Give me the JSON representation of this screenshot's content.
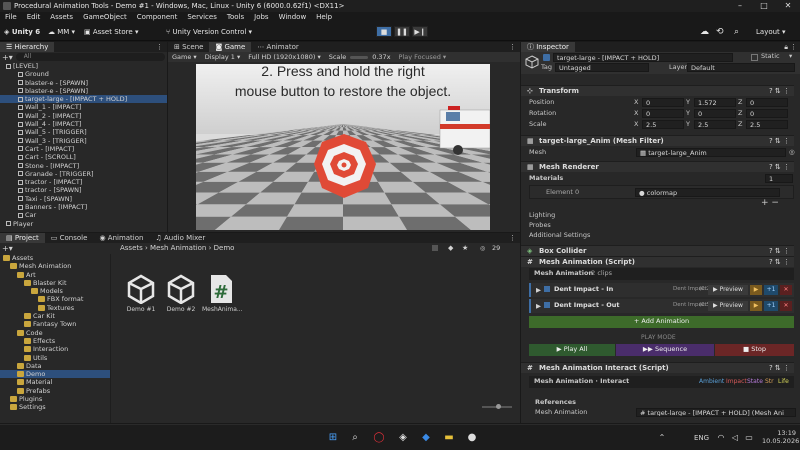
{
  "titlebar": {
    "title": "Procedural Animation Tools - Demo #1 - Windows, Mac, Linux - Unity 6 (6000.0.62f1) <DX11>"
  },
  "menu": [
    "File",
    "Edit",
    "Assets",
    "GameObject",
    "Component",
    "Services",
    "Tools",
    "Jobs",
    "Window",
    "Help"
  ],
  "toolbar": {
    "unity": "Unity 6",
    "account": "MM",
    "asset_store": "Asset Store",
    "version_control": "Unity Version Control",
    "layout": "Layout"
  },
  "hierarchy": {
    "tab": "Hierarchy",
    "search_placeholder": "All",
    "items": [
      {
        "label": "[LEVEL]"
      },
      {
        "label": "Ground"
      },
      {
        "label": "blaster-e - [SPAWN]"
      },
      {
        "label": "blaster-e - [SPAWN]"
      },
      {
        "label": "target-large - [IMPACT + HOLD]"
      },
      {
        "label": "Wall_1 - [IMPACT]"
      },
      {
        "label": "Wall_2 - [IMPACT]"
      },
      {
        "label": "Wall_4 - [IMPACT]"
      },
      {
        "label": "Wall_5 - [TRIGGER]"
      },
      {
        "label": "Wall_3 - [TRIGGER]"
      },
      {
        "label": "Cart - [IMPACT]"
      },
      {
        "label": "Cart - [SCROLL]"
      },
      {
        "label": "Stone - [IMPACT]"
      },
      {
        "label": "Granade - [TRIGGER]"
      },
      {
        "label": "tractor - [IMPACT]"
      },
      {
        "label": "tractor - [SPAWN]"
      },
      {
        "label": "Taxi - [SPAWN]"
      },
      {
        "label": "Banners - [IMPACT]"
      },
      {
        "label": "Car"
      },
      {
        "label": "Player"
      }
    ]
  },
  "scene_tabs": {
    "scene": "Scene",
    "game": "Game",
    "animator": "Animator"
  },
  "game_bar": {
    "game": "Game",
    "display": "Display 1",
    "resolution": "Full HD (1920x1080)",
    "scale_label": "Scale",
    "scale_value": "0.37x",
    "play_focused": "Play Focused"
  },
  "game_view": {
    "line1": "2. Press and hold the right",
    "line2": "mouse button to restore the object."
  },
  "project": {
    "tabs": {
      "project": "Project",
      "console": "Console",
      "animation": "Animation",
      "audio": "Audio Mixer"
    },
    "breadcrumb": [
      "Assets",
      "Mesh Animation",
      "Demo"
    ],
    "count": "29",
    "tree": [
      {
        "label": "Assets",
        "depth": 0
      },
      {
        "label": "Mesh Animation",
        "depth": 1
      },
      {
        "label": "Art",
        "depth": 2
      },
      {
        "label": "Blaster Kit",
        "depth": 3
      },
      {
        "label": "Models",
        "depth": 4
      },
      {
        "label": "FBX format",
        "depth": 5
      },
      {
        "label": "Textures",
        "depth": 5
      },
      {
        "label": "Car Kit",
        "depth": 3
      },
      {
        "label": "Fantasy Town",
        "depth": 3
      },
      {
        "label": "Code",
        "depth": 2
      },
      {
        "label": "Effects",
        "depth": 3
      },
      {
        "label": "Interaction",
        "depth": 3
      },
      {
        "label": "Utils",
        "depth": 3
      },
      {
        "label": "Data",
        "depth": 2
      },
      {
        "label": "Demo",
        "depth": 2,
        "selected": true
      },
      {
        "label": "Material",
        "depth": 2
      },
      {
        "label": "Prefabs",
        "depth": 2
      },
      {
        "label": "Plugins",
        "depth": 1
      },
      {
        "label": "Settings",
        "depth": 1
      }
    ],
    "assets": [
      {
        "label": "Demo #1",
        "icon": "unity-scene-icon"
      },
      {
        "label": "Demo #2",
        "icon": "unity-scene-icon"
      },
      {
        "label": "MeshAnima...",
        "icon": "csharp-script-icon"
      }
    ]
  },
  "inspector": {
    "tab": "Inspector",
    "name": "target-large - [IMPACT + HOLD]",
    "static": "Static",
    "tag_label": "Tag",
    "tag": "Untagged",
    "layer_label": "Layer",
    "layer": "Default",
    "transform": {
      "title": "Transform",
      "position": {
        "label": "Position",
        "x": "0",
        "y": "1.572",
        "z": "0"
      },
      "rotation": {
        "label": "Rotation",
        "x": "0",
        "y": "0",
        "z": "0"
      },
      "scale": {
        "label": "Scale",
        "x": "2.5",
        "y": "2.5",
        "z": "2.5"
      }
    },
    "mesh_filter": {
      "title": "target-large_Anim (Mesh Filter)",
      "mesh_label": "Mesh",
      "mesh": "target-large_Anim"
    },
    "mesh_renderer": {
      "title": "Mesh Renderer",
      "materials_label": "Materials",
      "materials_count": "1",
      "element_label": "Element 0",
      "element": "colormap",
      "lighting": "Lighting",
      "probes": "Probes",
      "additional": "Additional Settings"
    },
    "box_collider": "Box Collider",
    "mesh_animation": {
      "title": "Mesh Animation (Script)",
      "header": "Mesh Animation",
      "clips": "2 clips",
      "rows": [
        {
          "name": "Dent Impact - In",
          "tag": "Dent Impact",
          "time": "(0.2s)",
          "preview": "Preview"
        },
        {
          "name": "Dent Impact - Out",
          "tag": "Dent Impact",
          "time": "(0.5s)",
          "preview": "Preview"
        }
      ],
      "add": "+ Add Animation",
      "play_mode": "PLAY MODE",
      "play_all": "Play All",
      "sequence": "Sequence",
      "stop": "Stop",
      "plus_one": "+1"
    },
    "interact": {
      "title": "Mesh Animation Interact (Script)",
      "header": "Mesh Animation",
      "header_sep": "·",
      "header_sub": "Interact",
      "modes": [
        "Ambient",
        "Impact",
        "State",
        "Str",
        "Life"
      ],
      "references": "References",
      "ref_label": "Mesh Animation",
      "ref_value": "target-large - [IMPACT + HOLD] (Mesh Ani"
    }
  },
  "taskbar": {
    "lang": "ENG",
    "time": "13:19",
    "date": "10.05.2026"
  },
  "colors": {
    "accent": "#2d4f7c",
    "play_all": "#2f5a2f",
    "sequence": "#4a2d6b",
    "stop": "#6b2626",
    "add": "#3d6b2a"
  }
}
